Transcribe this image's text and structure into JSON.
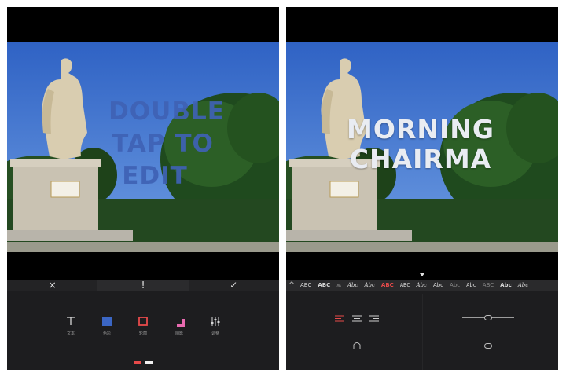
{
  "left_screen": {
    "overlay_lines": [
      "DOUBLE",
      "TAP TO",
      "EDIT"
    ],
    "actions": {
      "cancel_icon": "×",
      "info_icon": "!",
      "confirm_icon": "✓"
    },
    "tools": [
      {
        "label": "文本",
        "icon": "text-icon"
      },
      {
        "label": "色彩",
        "icon": "color-fill-icon"
      },
      {
        "label": "轮廓",
        "icon": "outline-icon"
      },
      {
        "label": "阴影",
        "icon": "shadow-icon"
      },
      {
        "label": "调整",
        "icon": "adjust-sliders-icon"
      }
    ],
    "page_indicator": {
      "count": 2,
      "active_index": 0
    }
  },
  "right_screen": {
    "overlay_lines": [
      "MORNING",
      "CHAIRMA"
    ],
    "font_collapse_icon": "^",
    "fonts": [
      "ABC",
      "ABC",
      "ʍ",
      "Abc",
      "Abc",
      "ABC",
      "ABC",
      "Abc",
      "Abc",
      "Abc",
      "Abc",
      "ABC",
      "Abc",
      "Abc"
    ],
    "selected_font_index": 5,
    "alignment_options": [
      "align-left",
      "align-center",
      "align-right"
    ],
    "selected_alignment": "align-left"
  },
  "colors": {
    "accent_red": "#e74a4a",
    "overlay_blue": "#3f62b5",
    "panel_background": "#1d1d1f"
  }
}
